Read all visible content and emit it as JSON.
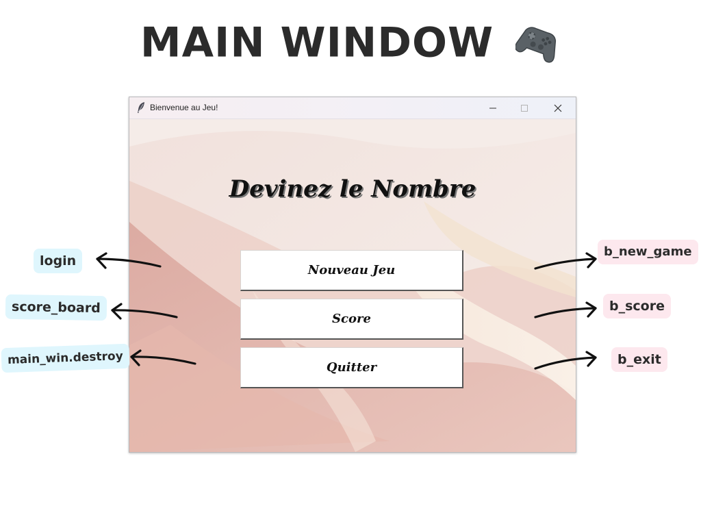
{
  "heading": {
    "title": "MAIN WINDOW"
  },
  "window": {
    "title": "Bienvenue au Jeu!",
    "controls": [
      "minimize",
      "maximize",
      "close"
    ]
  },
  "app": {
    "game_title": "Devinez le Nombre",
    "buttons": {
      "new_game": "Nouveau Jeu",
      "score": "Score",
      "exit": "Quitter"
    }
  },
  "annotations": {
    "left": {
      "login": "login",
      "score_board": "score_board",
      "destroy": "main_win.destroy"
    },
    "right": {
      "new_game": "b_new_game",
      "score": "b_score",
      "exit": "b_exit"
    }
  },
  "colors": {
    "tag_blue": "#dff6fd",
    "tag_pink": "#fde8ee",
    "background_peach": "#f3ece9",
    "background_rose": "#dcaea6"
  },
  "icons": {
    "heading": "game-controller-icon",
    "window": "feather-icon"
  }
}
